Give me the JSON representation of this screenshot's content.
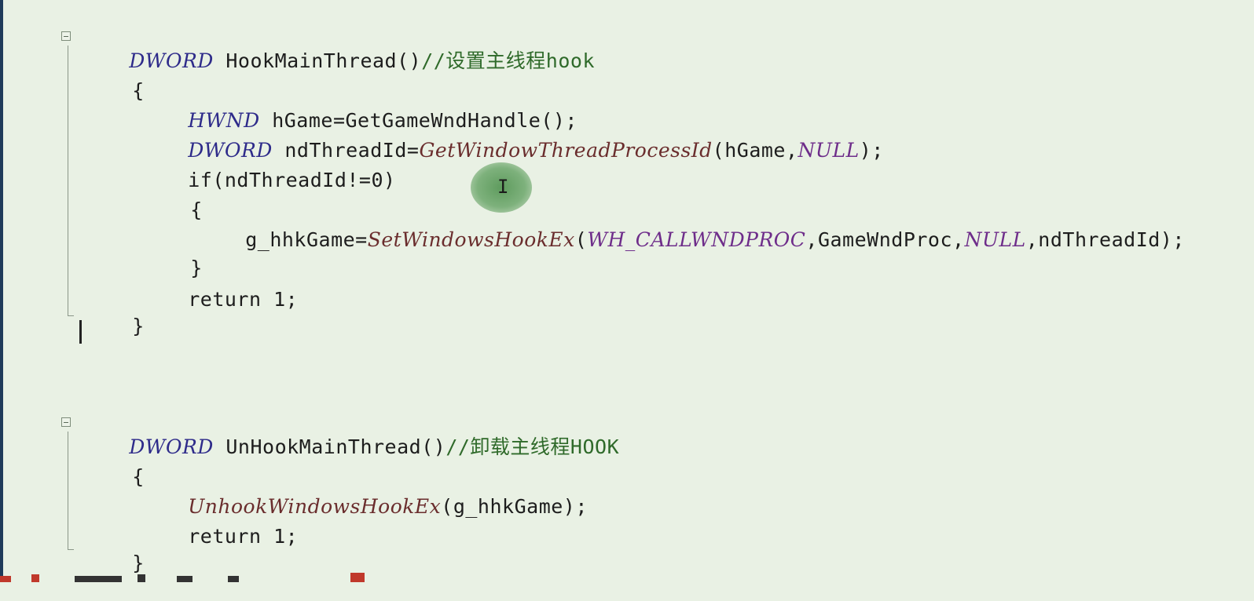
{
  "editor": {
    "lines": {
      "l1": {
        "type": "DWORD",
        "name": " HookMainThread()",
        "comment": "//设置主线程hook"
      },
      "l2": {
        "text": "{"
      },
      "l3": {
        "type": "HWND",
        "rest": " hGame=GetGameWndHandle();"
      },
      "l4": {
        "type": "DWORD",
        "mid": " ndThreadId=",
        "api": "GetWindowThreadProcessId",
        "pre": "(hGame,",
        "macro": "NULL",
        "post": ");"
      },
      "l5": {
        "text": "if(ndThreadId!=0)"
      },
      "l6": {
        "text": "{"
      },
      "l7": {
        "pre": "g_hhkGame=",
        "api": "SetWindowsHookEx",
        "open": "(",
        "macro1": "WH_CALLWNDPROC",
        "mid": ",GameWndProc,",
        "macro2": "NULL",
        "post": ",ndThreadId);"
      },
      "l8": {
        "text": "}"
      },
      "l9": {
        "text": "return 1;"
      },
      "l10": {
        "text": "}"
      },
      "l11": {
        "type": "DWORD",
        "name": " UnHookMainThread()",
        "comment": "//卸载主线程HOOK"
      },
      "l12": {
        "text": "{"
      },
      "l13": {
        "api": "UnhookWindowsHookEx",
        "rest": "(g_hhkGame);"
      },
      "l14": {
        "text": "return 1;"
      },
      "l15": {
        "text": "}"
      }
    },
    "cursor_glyph": "I"
  },
  "colors": {
    "background": "#e9f1e4",
    "type_keyword": "#2e2b8a",
    "api_function": "#6a2d2d",
    "macro": "#6e2d8a",
    "comment": "#2f6a2a",
    "cursor_highlight": "#4f9a4f"
  },
  "icons": [
    "fold-collapse-icon",
    "text-caret",
    "mouse-ibeam-icon"
  ]
}
